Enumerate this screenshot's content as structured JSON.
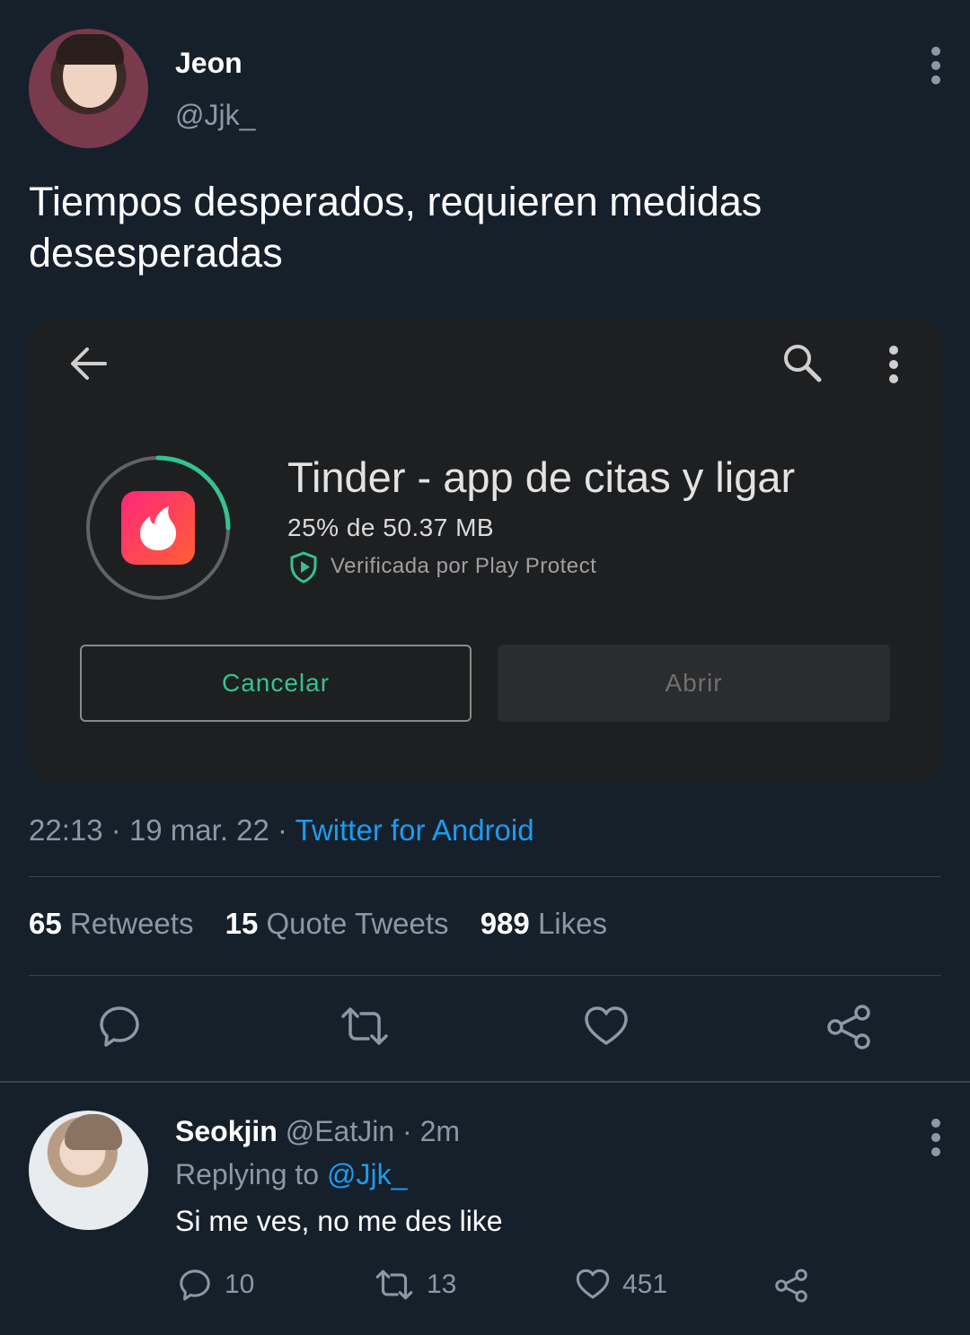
{
  "tweet": {
    "author_name": "Jeon",
    "author_handle": "@Jjk_",
    "text": "Tiempos desperados, requieren medidas desesperadas",
    "time": "22:13",
    "date": "19 mar. 22",
    "source": "Twitter for Android",
    "separator": "·",
    "stats": {
      "retweets_count": "65",
      "retweets_label": "Retweets",
      "quotes_count": "15",
      "quotes_label": "Quote Tweets",
      "likes_count": "989",
      "likes_label": "Likes"
    }
  },
  "screenshot": {
    "app_title": "Tinder - app de citas y ligar",
    "download_progress": "25% de 50.37 MB",
    "progress_fraction": 0.25,
    "verified_text": "Verificada por Play Protect",
    "cancel_label": "Cancelar",
    "open_label": "Abrir",
    "icons": [
      "back-arrow-icon",
      "search-icon",
      "more-vert-icon",
      "tinder-flame-icon",
      "play-protect-shield-icon"
    ]
  },
  "reply": {
    "author_name": "Seokjin",
    "author_handle": "@EatJin",
    "age": "· 2m",
    "replying_prefix": "Replying to",
    "replying_to": "@Jjk_",
    "text": "Si me ves, no me des like",
    "reply_count": "10",
    "retweet_count": "13",
    "like_count": "451"
  },
  "colors": {
    "background": "#15202b",
    "link": "#1d9bf0",
    "muted": "#8b98a5",
    "accent_green": "#34c38f",
    "tinder": "#fd4f68"
  }
}
